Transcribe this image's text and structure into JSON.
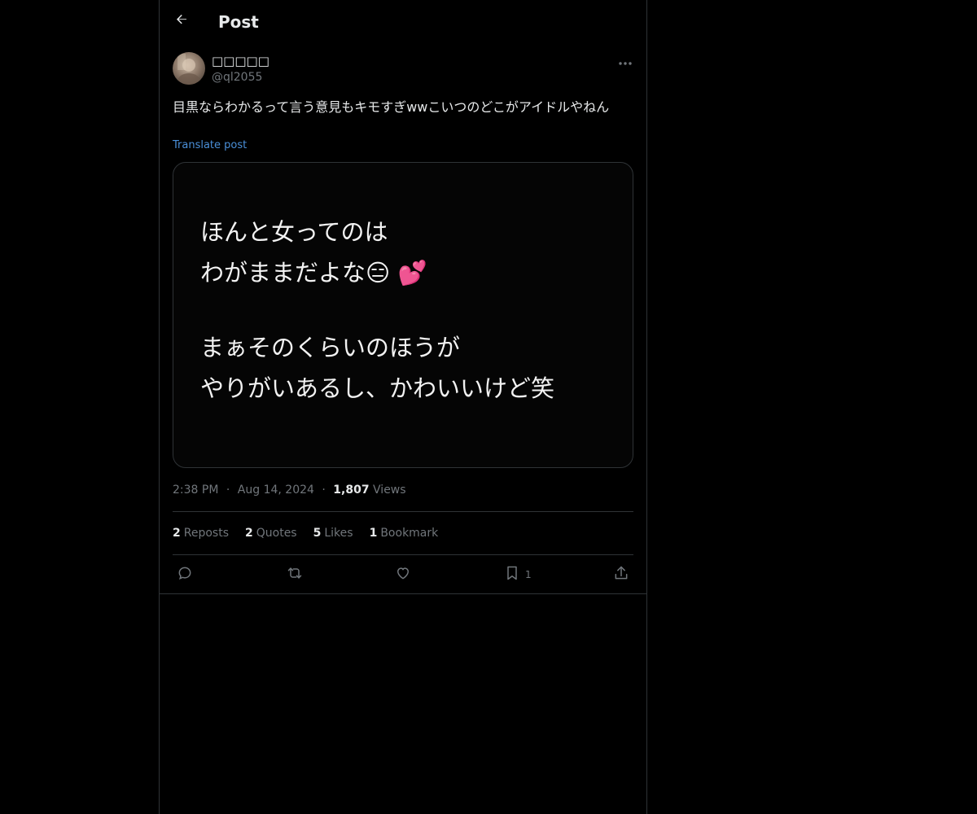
{
  "header": {
    "title": "Post",
    "back_icon": "arrow-left-icon"
  },
  "author": {
    "display_name": "□□□□□",
    "handle": "@ql2055"
  },
  "post": {
    "text": "目黒ならわかるって言う意見もキモすぎwwこいつのどこがアイドルやねん",
    "translate_label": "Translate post",
    "image_lines": [
      "ほんと女ってのは",
      "わがままだよな😑 💕",
      "まぁそのくらいのほうが",
      "やりがいあるし、かわいいけど笑"
    ]
  },
  "meta": {
    "time": "2:38 PM",
    "date": "Aug 14, 2024",
    "views_count": "1,807",
    "views_label": "Views"
  },
  "stats": {
    "reposts_count": "2",
    "reposts_label": "Reposts",
    "quotes_count": "2",
    "quotes_label": "Quotes",
    "likes_count": "5",
    "likes_label": "Likes",
    "bookmarks_count": "1",
    "bookmarks_label": "Bookmark"
  },
  "actions": {
    "bookmark_count": "1"
  },
  "colors": {
    "background": "#000000",
    "text": "#e7e9ea",
    "secondary_text": "#71767b",
    "link": "#4a8fd8",
    "border": "#2f3336"
  }
}
